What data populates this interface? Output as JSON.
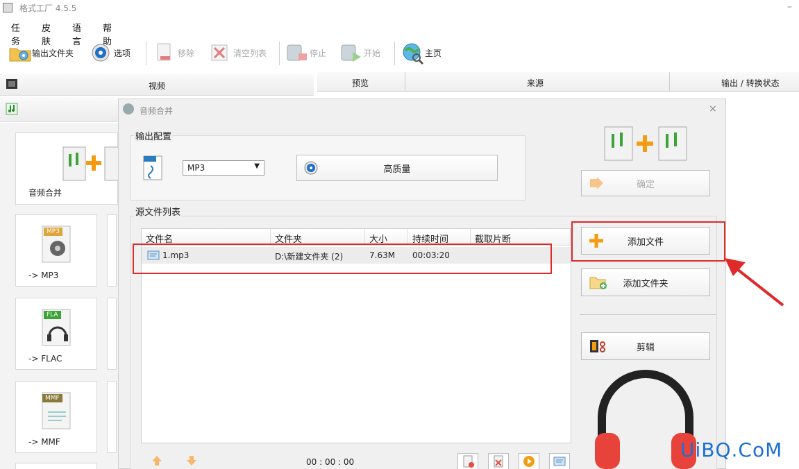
{
  "window": {
    "title": "格式工厂 4.5.5",
    "minimize": "–"
  },
  "menu": [
    "任务",
    "皮肤",
    "语言",
    "帮助"
  ],
  "toolbar": {
    "output_folder": "输出文件夹",
    "options": "选项",
    "remove": "移除",
    "clear_list": "清空列表",
    "stop": "停止",
    "start": "开始",
    "home": "主页"
  },
  "left_panel": {
    "video_label": "视频",
    "tiles": [
      "音频合并",
      "-> MP3",
      "-> FLAC",
      "-> MMF"
    ],
    "badges": {
      "mp3": "MP3",
      "fla": "FLA",
      "mmf": "MMF"
    }
  },
  "right_header": {
    "preview": "预览",
    "source": "来源",
    "status": "输出 / 转换状态"
  },
  "dialog": {
    "title": "音频合并",
    "close": "×",
    "output_config": {
      "title": "输出配置",
      "format_selected": "MP3",
      "quality_button": "高质量"
    },
    "confirm_button": "确定",
    "source_list": {
      "title": "源文件列表",
      "columns": [
        "文件名",
        "文件夹",
        "大小",
        "持续时间",
        "截取片断"
      ],
      "rows": [
        {
          "name": "1.mp3",
          "folder": "D:\\新建文件夹 (2)",
          "size": "7.63M",
          "duration": "00:03:20",
          "clip": ""
        }
      ]
    },
    "buttons": {
      "add_file": "添加文件",
      "add_folder": "添加文件夹",
      "edit": "剪辑"
    },
    "time": "00 : 00 : 00"
  },
  "watermark": "UiBQ.CoM",
  "colors": {
    "accent_red": "#e02a2a",
    "orange": "#f39c12",
    "green": "#5aa84a",
    "headphone_red": "#e8433b"
  }
}
